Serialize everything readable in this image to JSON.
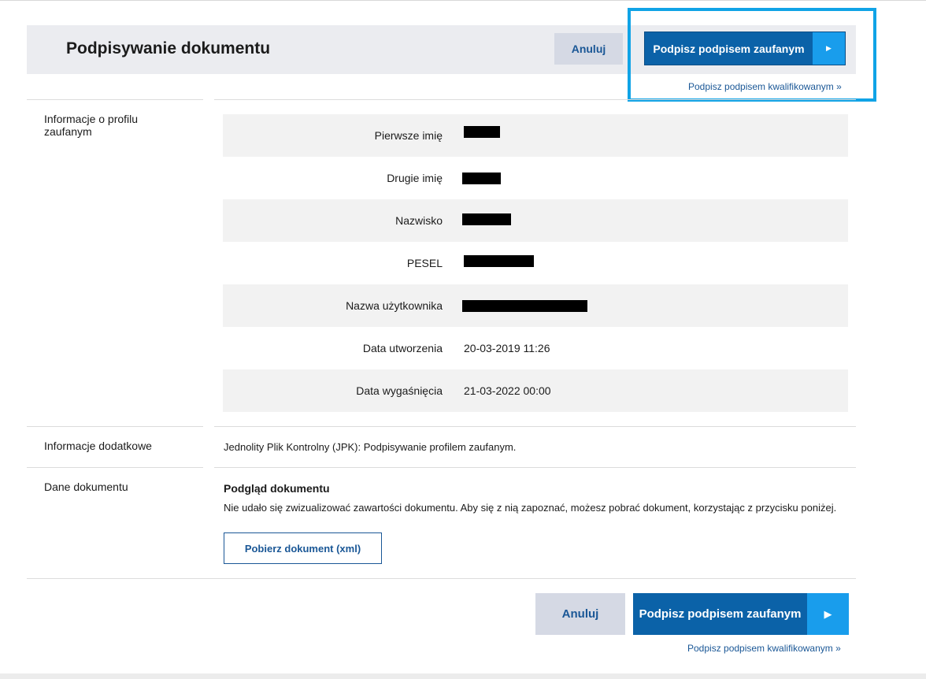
{
  "header": {
    "title": "Podpisywanie dokumentu"
  },
  "actions": {
    "cancel_label": "Anuluj",
    "sign_trusted_label": "Podpisz podpisem zaufanym",
    "sign_arrow_icon": "play-triangle-icon",
    "sign_arrow_glyph": "▶",
    "sign_qualified_link": "Podpisz podpisem kwalifikowanym »"
  },
  "sections": {
    "profile_label": "Informacje o profilu zaufanym",
    "additional_label": "Informacje dodatkowe",
    "document_label": "Dane dokumentu"
  },
  "profile": {
    "rows": [
      {
        "label": "Pierwsze imię",
        "value": "",
        "redacted": true
      },
      {
        "label": "Drugie imię",
        "value": "",
        "redacted": true
      },
      {
        "label": "Nazwisko",
        "value": "",
        "redacted": true
      },
      {
        "label": "PESEL",
        "value": "",
        "redacted": true
      },
      {
        "label": "Nazwa użytkownika",
        "value": "",
        "redacted": true
      },
      {
        "label": "Data utworzenia",
        "value": "20-03-2019 11:26",
        "redacted": false
      },
      {
        "label": "Data wygaśnięcia",
        "value": "21-03-2022 00:00",
        "redacted": false
      }
    ]
  },
  "additional_info": {
    "text": "Jednolity Plik Kontrolny (JPK): Podpisywanie profilem zaufanym."
  },
  "document": {
    "preview_title": "Podgląd dokumentu",
    "preview_text": "Nie udało się zwizualizować zawartości dokumentu. Aby się z nią zapoznać, możesz pobrać dokument, korzystając z przycisku poniżej.",
    "download_label": "Pobierz dokument (xml)"
  },
  "colors": {
    "primary": "#0b62a8",
    "accent": "#199dec",
    "highlight": "#10a3e6",
    "secondary_button": "#d5d9e4"
  }
}
